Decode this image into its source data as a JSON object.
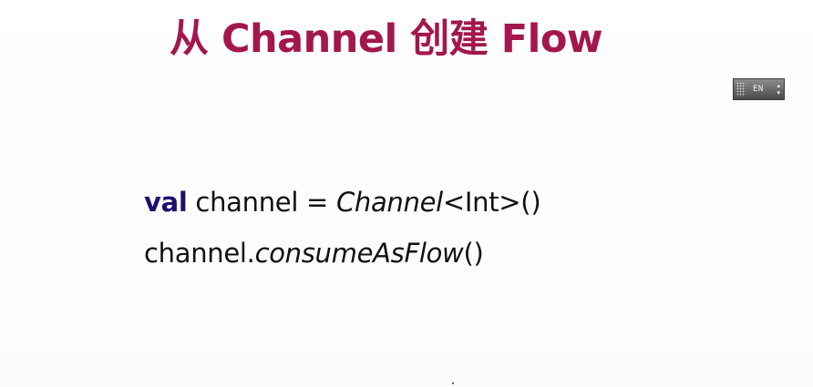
{
  "slide": {
    "title": "从 Channel 创建 Flow",
    "code_lines": [
      {
        "tokens": [
          {
            "text": "val",
            "style": "keyword"
          },
          {
            "text": " channel = ",
            "style": "plain"
          },
          {
            "text": "Channel",
            "style": "italic"
          },
          {
            "text": "<Int>()",
            "style": "plain"
          }
        ]
      },
      {
        "tokens": [
          {
            "text": "channel.",
            "style": "plain"
          },
          {
            "text": "consumeAsFlow",
            "style": "italic"
          },
          {
            "text": "()",
            "style": "plain"
          }
        ]
      }
    ]
  },
  "ime_toolbar": {
    "language": "EN",
    "grip_icon": "grip-dots-icon",
    "up_icon": "caret-up-icon",
    "down_icon": "caret-down-icon",
    "up_glyph": "▴",
    "down_glyph": "▾"
  },
  "colors": {
    "title": "#a3174c",
    "keyword": "#1a1270",
    "code_text": "#111111",
    "background": "#ffffff"
  }
}
